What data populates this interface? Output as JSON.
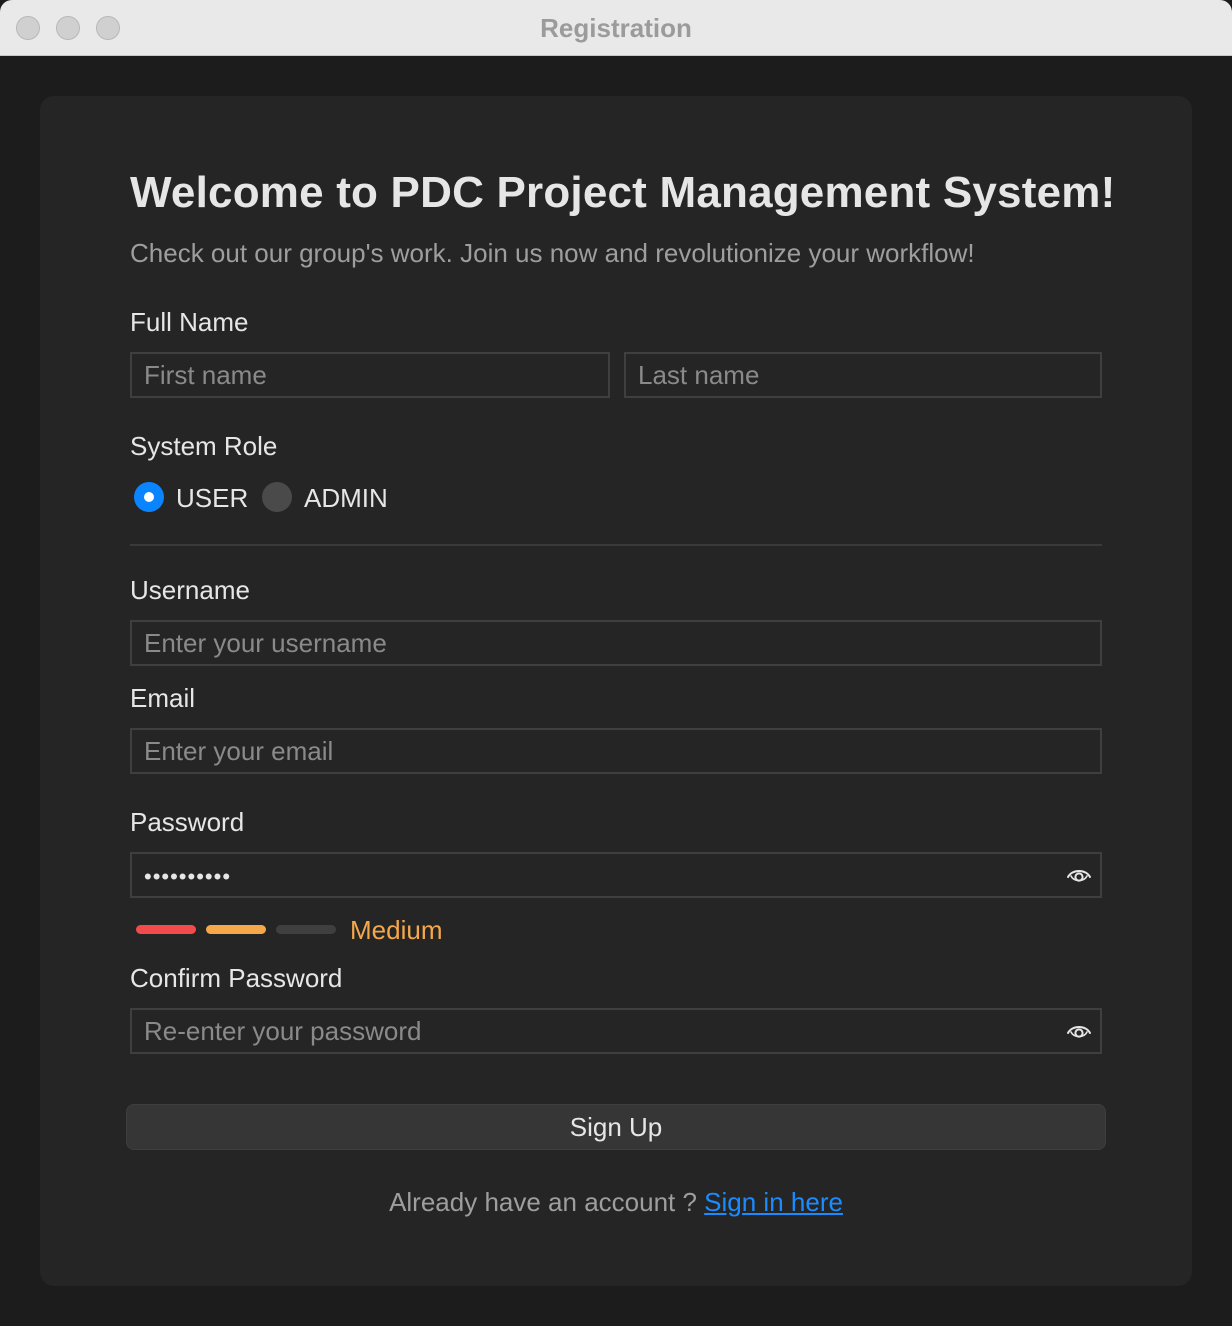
{
  "window": {
    "title": "Registration"
  },
  "form": {
    "heading": "Welcome to PDC Project Management System!",
    "subtitle": "Check out our group's work. Join us now and revolutionize your workflow!",
    "full_name": {
      "label": "Full Name",
      "first_placeholder": "First name",
      "last_placeholder": "Last name"
    },
    "role": {
      "label": "System Role",
      "options": [
        "USER",
        "ADMIN"
      ],
      "selected": "USER"
    },
    "username": {
      "label": "Username",
      "placeholder": "Enter your username"
    },
    "email": {
      "label": "Email",
      "placeholder": "Enter your email"
    },
    "password": {
      "label": "Password",
      "value": "••••••••••",
      "strength_label": "Medium",
      "strength_level": 2,
      "strength_max": 3
    },
    "confirm_password": {
      "label": "Confirm Password",
      "placeholder": "Re-enter your password"
    },
    "signup_label": "Sign Up",
    "footer_text": "Already have an account ? ",
    "signin_link": "Sign in here"
  },
  "colors": {
    "accent": "#0a84ff",
    "link": "#1a8cff",
    "strength_weak": "#f24b4b",
    "strength_medium": "#f5a84a",
    "strength_empty": "#3f3f3f"
  }
}
